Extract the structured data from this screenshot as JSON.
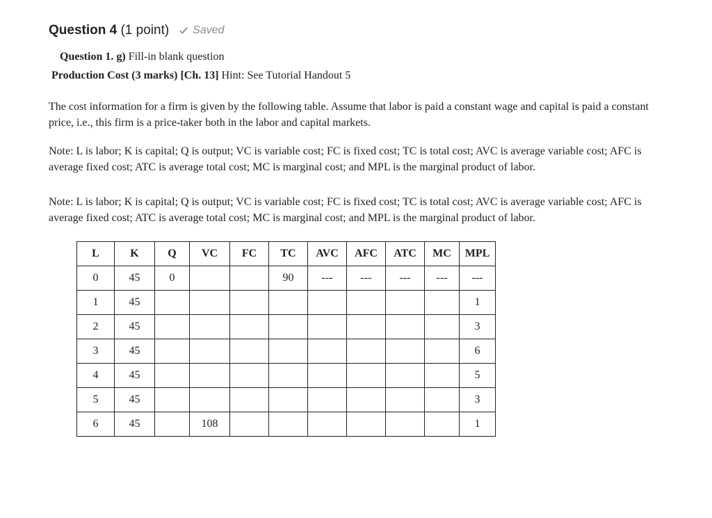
{
  "header": {
    "title": "Question 4",
    "points": "(1 point)",
    "saved": "Saved"
  },
  "sub": {
    "lead_bold": "Question 1. g)",
    "lead_rest": " Fill-in blank question",
    "prod_bold": "Production Cost (3 marks) [Ch. 13]",
    "prod_rest": " Hint: See Tutorial Handout 5"
  },
  "paragraphs": {
    "p1": "The cost information for a firm is given by the following table. Assume that labor is paid a constant wage and capital is paid a constant price, i.e., this firm is a price-taker both in the labor and capital markets.",
    "p2": "Note: L is labor; K is capital; Q is output; VC is variable cost; FC is fixed cost; TC is total cost; AVC is average variable cost; AFC is average fixed cost; ATC is average total cost; MC is marginal cost; and MPL is the marginal product of labor.",
    "p3": "Note: L is labor; K is capital; Q is output; VC is variable cost; FC is fixed cost; TC is total cost; AVC is average variable cost; AFC is average fixed cost; ATC is average total cost; MC is marginal cost; and MPL is the marginal product of labor."
  },
  "table": {
    "headers": [
      "L",
      "K",
      "Q",
      "VC",
      "FC",
      "TC",
      "AVC",
      "AFC",
      "ATC",
      "MC",
      "MPL"
    ],
    "rows": [
      {
        "L": "0",
        "K": "45",
        "Q": "0",
        "VC": "",
        "FC": "",
        "TC": "90",
        "AVC": "---",
        "AFC": "---",
        "ATC": "---",
        "MC": "---",
        "MPL": "---"
      },
      {
        "L": "1",
        "K": "45",
        "Q": "",
        "VC": "",
        "FC": "",
        "TC": "",
        "AVC": "",
        "AFC": "",
        "ATC": "",
        "MC": "",
        "MPL": "1"
      },
      {
        "L": "2",
        "K": "45",
        "Q": "",
        "VC": "",
        "FC": "",
        "TC": "",
        "AVC": "",
        "AFC": "",
        "ATC": "",
        "MC": "",
        "MPL": "3"
      },
      {
        "L": "3",
        "K": "45",
        "Q": "",
        "VC": "",
        "FC": "",
        "TC": "",
        "AVC": "",
        "AFC": "",
        "ATC": "",
        "MC": "",
        "MPL": "6"
      },
      {
        "L": "4",
        "K": "45",
        "Q": "",
        "VC": "",
        "FC": "",
        "TC": "",
        "AVC": "",
        "AFC": "",
        "ATC": "",
        "MC": "",
        "MPL": "5"
      },
      {
        "L": "5",
        "K": "45",
        "Q": "",
        "VC": "",
        "FC": "",
        "TC": "",
        "AVC": "",
        "AFC": "",
        "ATC": "",
        "MC": "",
        "MPL": "3"
      },
      {
        "L": "6",
        "K": "45",
        "Q": "",
        "VC": "108",
        "FC": "",
        "TC": "",
        "AVC": "",
        "AFC": "",
        "ATC": "",
        "MC": "",
        "MPL": "1"
      }
    ]
  }
}
